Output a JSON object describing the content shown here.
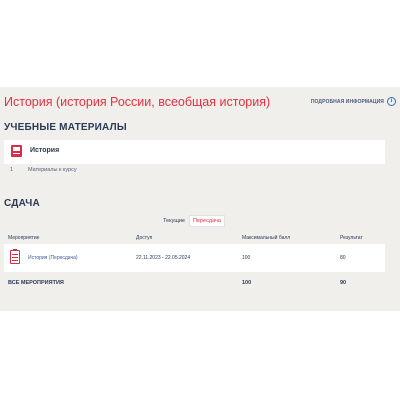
{
  "course": {
    "title": "История (история России, всеобщая история)",
    "more_info_label": "ПОДРОБНАЯ ИНФОРМАЦИЯ"
  },
  "materials": {
    "section_title": "УЧЕБНЫЕ МАТЕРИАЛЫ",
    "item_title": "История",
    "sub_number": "1",
    "sub_label": "Материалы к курсу"
  },
  "exams": {
    "section_title": "СДАЧА",
    "tabs": [
      "Текущие",
      "Пересдача"
    ],
    "active_tab": 1,
    "columns": [
      "Мероприятие",
      "Доступ",
      "Максимальный балл",
      "Результат"
    ],
    "rows": [
      {
        "event": "История (Пересдача)",
        "access": "22.11.2023 - 22.05.2024",
        "max": "100",
        "result": "80"
      }
    ],
    "total": {
      "label": "ВСЕ МЕРОПРИЯТИЯ",
      "max": "100",
      "result": "90"
    }
  },
  "colors": {
    "accent": "#e4303f",
    "panel": "#f0efec",
    "text": "#2b3a55"
  }
}
